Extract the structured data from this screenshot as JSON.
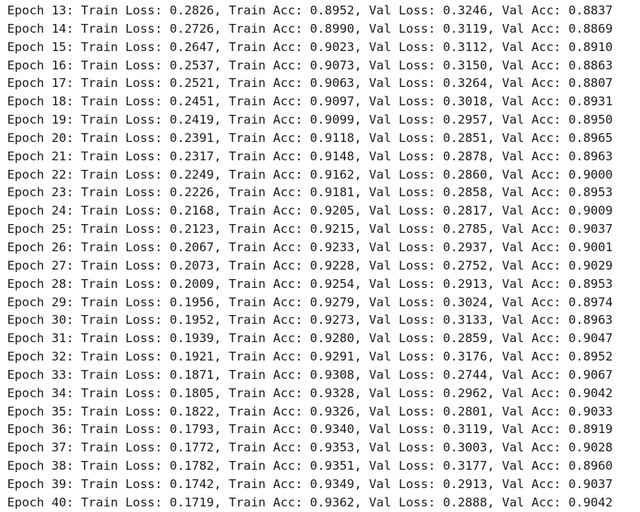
{
  "output": {
    "lines": [
      "Epoch 13: Train Loss: 0.2826, Train Acc: 0.8952, Val Loss: 0.3246, Val Acc: 0.8837",
      "Epoch 14: Train Loss: 0.2726, Train Acc: 0.8990, Val Loss: 0.3119, Val Acc: 0.8869",
      "Epoch 15: Train Loss: 0.2647, Train Acc: 0.9023, Val Loss: 0.3112, Val Acc: 0.8910",
      "Epoch 16: Train Loss: 0.2537, Train Acc: 0.9073, Val Loss: 0.3150, Val Acc: 0.8863",
      "Epoch 17: Train Loss: 0.2521, Train Acc: 0.9063, Val Loss: 0.3264, Val Acc: 0.8807",
      "Epoch 18: Train Loss: 0.2451, Train Acc: 0.9097, Val Loss: 0.3018, Val Acc: 0.8931",
      "Epoch 19: Train Loss: 0.2419, Train Acc: 0.9099, Val Loss: 0.2957, Val Acc: 0.8950",
      "Epoch 20: Train Loss: 0.2391, Train Acc: 0.9118, Val Loss: 0.2851, Val Acc: 0.8965",
      "Epoch 21: Train Loss: 0.2317, Train Acc: 0.9148, Val Loss: 0.2878, Val Acc: 0.8963",
      "Epoch 22: Train Loss: 0.2249, Train Acc: 0.9162, Val Loss: 0.2860, Val Acc: 0.9000",
      "Epoch 23: Train Loss: 0.2226, Train Acc: 0.9181, Val Loss: 0.2858, Val Acc: 0.8953",
      "Epoch 24: Train Loss: 0.2168, Train Acc: 0.9205, Val Loss: 0.2817, Val Acc: 0.9009",
      "Epoch 25: Train Loss: 0.2123, Train Acc: 0.9215, Val Loss: 0.2785, Val Acc: 0.9037",
      "Epoch 26: Train Loss: 0.2067, Train Acc: 0.9233, Val Loss: 0.2937, Val Acc: 0.9001",
      "Epoch 27: Train Loss: 0.2073, Train Acc: 0.9228, Val Loss: 0.2752, Val Acc: 0.9029",
      "Epoch 28: Train Loss: 0.2009, Train Acc: 0.9254, Val Loss: 0.2913, Val Acc: 0.8953",
      "Epoch 29: Train Loss: 0.1956, Train Acc: 0.9279, Val Loss: 0.3024, Val Acc: 0.8974",
      "Epoch 30: Train Loss: 0.1952, Train Acc: 0.9273, Val Loss: 0.3133, Val Acc: 0.8963",
      "Epoch 31: Train Loss: 0.1939, Train Acc: 0.9280, Val Loss: 0.2859, Val Acc: 0.9047",
      "Epoch 32: Train Loss: 0.1921, Train Acc: 0.9291, Val Loss: 0.3176, Val Acc: 0.8952",
      "Epoch 33: Train Loss: 0.1871, Train Acc: 0.9308, Val Loss: 0.2744, Val Acc: 0.9067",
      "Epoch 34: Train Loss: 0.1805, Train Acc: 0.9328, Val Loss: 0.2962, Val Acc: 0.9042",
      "Epoch 35: Train Loss: 0.1822, Train Acc: 0.9326, Val Loss: 0.2801, Val Acc: 0.9033",
      "Epoch 36: Train Loss: 0.1793, Train Acc: 0.9340, Val Loss: 0.3119, Val Acc: 0.8919",
      "Epoch 37: Train Loss: 0.1772, Train Acc: 0.9353, Val Loss: 0.3003, Val Acc: 0.9028",
      "Epoch 38: Train Loss: 0.1782, Train Acc: 0.9351, Val Loss: 0.3177, Val Acc: 0.8960",
      "Epoch 39: Train Loss: 0.1742, Train Acc: 0.9349, Val Loss: 0.2913, Val Acc: 0.9037",
      "Epoch 40: Train Loss: 0.1719, Train Acc: 0.9362, Val Loss: 0.2888, Val Acc: 0.9042"
    ]
  }
}
